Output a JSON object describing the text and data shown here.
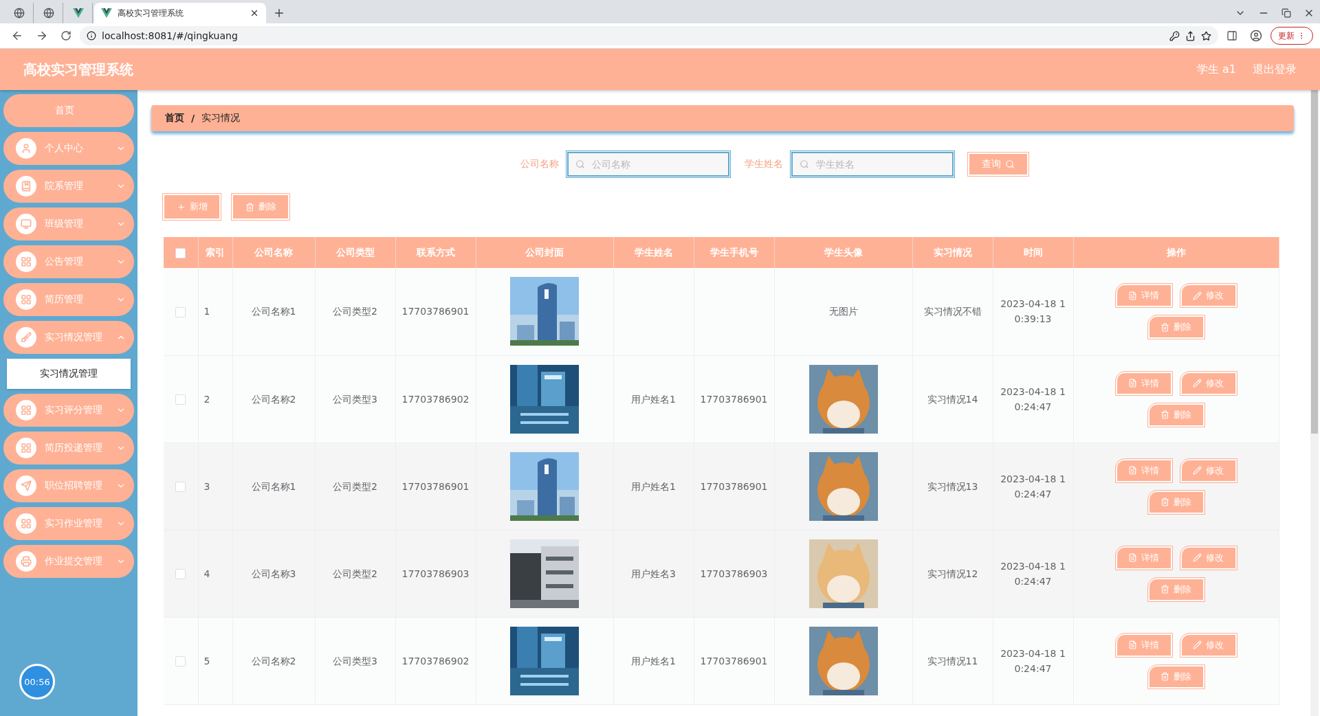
{
  "browser": {
    "tabs": [
      {
        "kind": "globe",
        "selected": false
      },
      {
        "kind": "globe",
        "selected": false
      },
      {
        "kind": "vue",
        "selected": false
      },
      {
        "kind": "page",
        "title": "高校实习管理系统",
        "selected": true
      }
    ],
    "address": "localhost:8081/#/qingkuang",
    "update_button": "更新"
  },
  "header": {
    "title": "高校实习管理系统",
    "user": "学生 a1",
    "logout": "退出登录"
  },
  "sidebar": {
    "items": [
      {
        "kind": "link",
        "label": "首页"
      },
      {
        "kind": "menu",
        "label": "个人中心",
        "expanded": false
      },
      {
        "kind": "menu",
        "label": "院系管理",
        "expanded": false
      },
      {
        "kind": "menu",
        "label": "班级管理",
        "expanded": false
      },
      {
        "kind": "menu",
        "label": "公告管理",
        "expanded": false
      },
      {
        "kind": "menu",
        "label": "简历管理",
        "expanded": false
      },
      {
        "kind": "menu",
        "label": "实习情况管理",
        "expanded": true,
        "children": [
          {
            "label": "实习情况管理",
            "selected": true
          }
        ]
      },
      {
        "kind": "menu",
        "label": "实习评分管理",
        "expanded": false
      },
      {
        "kind": "menu",
        "label": "简历投递管理",
        "expanded": false
      },
      {
        "kind": "menu",
        "label": "职位招聘管理",
        "expanded": false
      },
      {
        "kind": "menu",
        "label": "实习作业管理",
        "expanded": false
      },
      {
        "kind": "menu",
        "label": "作业提交管理",
        "expanded": false
      }
    ]
  },
  "breadcrumb": [
    "首页",
    "实习情况"
  ],
  "breadcrumb_separator": "/",
  "search": {
    "fields": [
      {
        "label": "公司名称",
        "placeholder": "公司名称"
      },
      {
        "label": "学生姓名",
        "placeholder": "学生姓名"
      }
    ],
    "button": "查询"
  },
  "toolbar": [
    {
      "kind": "add",
      "label": "新增"
    },
    {
      "kind": "delete",
      "label": "删除"
    }
  ],
  "table": {
    "select_all_checked": false,
    "columns": [
      "索引",
      "公司名称",
      "公司类型",
      "联系方式",
      "公司封面",
      "学生姓名",
      "学生手机号",
      "学生头像",
      "实习情况",
      "时间",
      "操作"
    ],
    "rows": [
      {
        "checked": false,
        "index": "1",
        "company": "公司名称1",
        "type": "公司类型2",
        "phone": "17703786901",
        "cover": {
          "kind": "picture"
        },
        "avatar": {
          "kind": "none",
          "text": "无图片"
        },
        "status": "实习情况不错",
        "time": "2023-04-18 10:39:13",
        "actions": [
          "详情",
          "修改",
          "删除"
        ]
      },
      {
        "checked": false,
        "index": "2",
        "company": "公司名称2",
        "type": "公司类型3",
        "phone": "17703786902",
        "cover": {
          "kind": "picture"
        },
        "student": "用户姓名1",
        "student_phone": "17703786901",
        "avatar": {
          "kind": "picture"
        },
        "status": "实习情况14",
        "time": "2023-04-18 10:24:47",
        "actions": [
          "详情",
          "修改",
          "删除"
        ]
      },
      {
        "checked": false,
        "index": "3",
        "company": "公司名称1",
        "type": "公司类型2",
        "phone": "17703786901",
        "cover": {
          "kind": "picture"
        },
        "student": "用户姓名1",
        "student_phone": "17703786901",
        "avatar": {
          "kind": "picture"
        },
        "status": "实习情况13",
        "time": "2023-04-18 10:24:47",
        "actions": [
          "详情",
          "修改",
          "删除"
        ]
      },
      {
        "checked": false,
        "index": "4",
        "company": "公司名称3",
        "type": "公司类型2",
        "phone": "17703786903",
        "cover": {
          "kind": "picture"
        },
        "student": "用户姓名3",
        "student_phone": "17703786903",
        "avatar": {
          "kind": "picture"
        },
        "status": "实习情况12",
        "time": "2023-04-18 10:24:47",
        "actions": [
          "详情",
          "修改",
          "删除"
        ]
      },
      {
        "checked": false,
        "index": "5",
        "company": "公司名称2",
        "type": "公司类型3",
        "phone": "17703786902",
        "cover": {
          "kind": "picture"
        },
        "student": "用户姓名1",
        "student_phone": "17703786901",
        "avatar": {
          "kind": "picture"
        },
        "status": "实习情况11",
        "time": "2023-04-18 10:24:47",
        "actions": [
          "详情",
          "修改",
          "删除"
        ]
      }
    ]
  },
  "timer": "00:56"
}
